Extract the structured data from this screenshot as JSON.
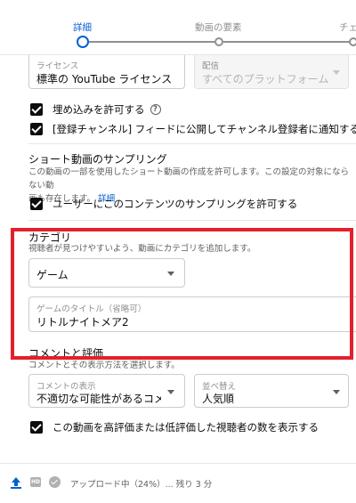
{
  "steps": [
    {
      "label": "詳細",
      "active": true
    },
    {
      "label": "動画の要素",
      "active": false
    },
    {
      "label": "チェ",
      "active": false
    }
  ],
  "license": {
    "label": "ライセンス",
    "value": "標準の YouTube ライセンス"
  },
  "distribution": {
    "label": "配信",
    "value": "すべてのプラットフォーム"
  },
  "checkboxes": {
    "embed": "埋め込みを許可する",
    "subscription_feed": "[登録チャンネル] フィードに公開してチャンネル登録者に通知する"
  },
  "shorts_sampling": {
    "title": "ショート動画のサンプリング",
    "desc_line1": "この動画の一部を使用したショート動画の作成を許可します。この設定の対象にならない動",
    "desc_line2": "画も存在します。",
    "link": "詳細",
    "checkbox": "ユーザーにこのコンテンツのサンプリングを許可する"
  },
  "category": {
    "title": "カテゴリ",
    "desc": "視聴者が見つけやすいよう、動画にカテゴリを追加します。",
    "selected": "ゲーム",
    "game_title_label": "ゲームのタイトル（省略可）",
    "game_title_value": "リトルナイトメア2"
  },
  "comments": {
    "title": "コメントと評価",
    "desc": "コメントとその表示方法を選択します。",
    "visibility_label": "コメントの表示",
    "visibility_value": "不適切な可能性があるコメ...",
    "sort_label": "並べ替え",
    "sort_value": "人気順",
    "ratings_checkbox": "この動画を高評価または低評価した視聴者の数を表示する"
  },
  "footer": {
    "hd_badge": "HD",
    "status": "アップロード中（24%）... 残り 3 分"
  },
  "colors": {
    "accent": "#065fd4",
    "highlight": "#e3202b"
  }
}
